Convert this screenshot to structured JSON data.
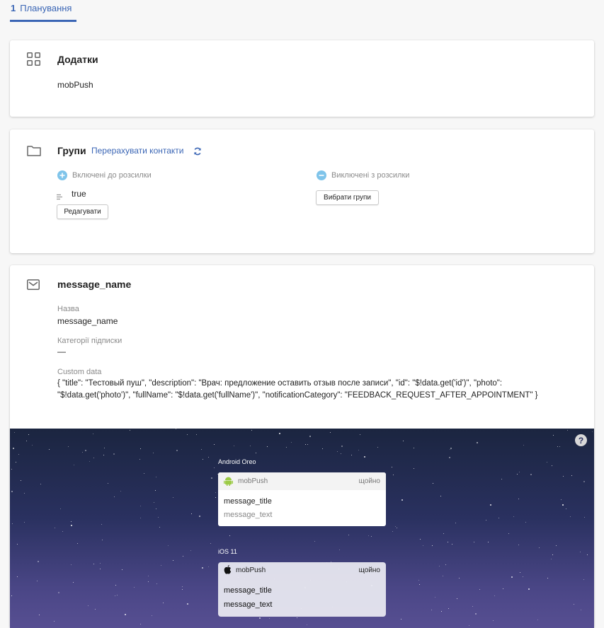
{
  "tabs": [
    {
      "num": "1",
      "label": "Планування"
    }
  ],
  "apps_card": {
    "title": "Додатки",
    "app": "mobPush"
  },
  "groups_card": {
    "title": "Групи",
    "recalc_link": "Перерахувати контакти",
    "included_label": "Включені до розсилки",
    "excluded_label": "Виключені з розсилки",
    "included_item": "true",
    "edit_button": "Редагувати",
    "choose_groups_button": "Вибрати групи"
  },
  "message_card": {
    "title": "message_name",
    "name_label": "Назва",
    "name_value": "message_name",
    "categories_label": "Категорії підписки",
    "categories_value": "—",
    "custom_data_label": "Custom data",
    "custom_data_line1": "{ \"title\": \"Тестовый пуш\", \"description\": \"Врач: предложение оставить отзыв после записи\", \"id\": \"$!data.get('id')\", \"photo\":",
    "custom_data_line2": "\"$!data.get('photo')\", \"fullName\": \"$!data.get('fullName')\", \"notificationCategory\": \"FEEDBACK_REQUEST_AFTER_APPOINTMENT\" }"
  },
  "preview": {
    "android_label": "Android Oreo",
    "ios_label": "iOS 11",
    "android": {
      "app": "mobPush",
      "time": "щойно",
      "title": "message_title",
      "text": "message_text"
    },
    "ios": {
      "app": "mobPush",
      "time": "щойно",
      "title": "message_title",
      "text": "message_text"
    }
  },
  "colors": {
    "accent": "#3b66b5",
    "included": "#7fc4ea",
    "android": "#9ccb46"
  }
}
